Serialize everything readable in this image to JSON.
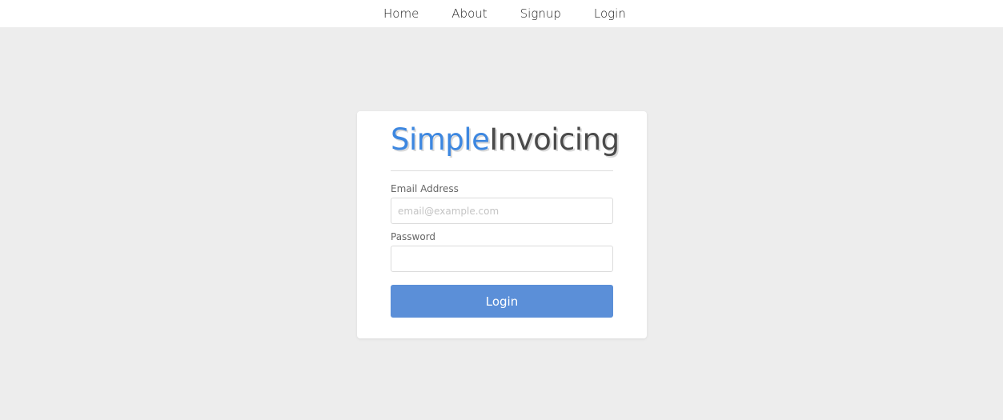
{
  "nav": {
    "items": [
      {
        "label": "Home"
      },
      {
        "label": "About"
      },
      {
        "label": "Signup"
      },
      {
        "label": "Login"
      }
    ]
  },
  "brand": {
    "part1": "Simple",
    "part2": "Invoicing",
    "color_part1": "#3d87e0",
    "color_part2": "#4a4a4a"
  },
  "form": {
    "email_label": "Email Address",
    "email_placeholder": "email@example.com",
    "email_value": "",
    "password_label": "Password",
    "password_value": "",
    "submit_label": "Login",
    "submit_color": "#5b8fd8"
  }
}
